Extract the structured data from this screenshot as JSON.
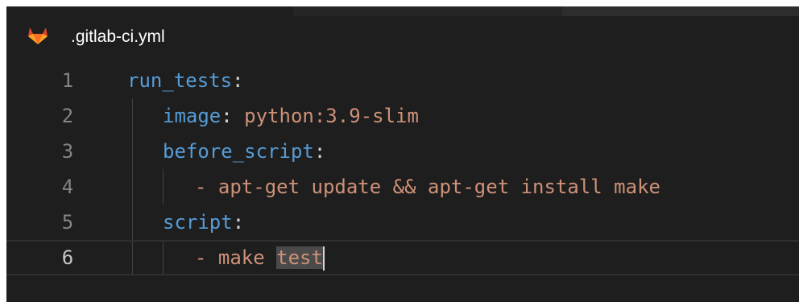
{
  "tab": {
    "filename": ".gitlab-ci.yml",
    "icon": "gitlab-icon"
  },
  "colors": {
    "background": "#1e1e1e",
    "yaml_key": "#569cd6",
    "yaml_value": "#ce9178",
    "line_number": "#858585",
    "line_number_current": "#c6c6c6",
    "gitlab_orange": "#e24329"
  },
  "editor": {
    "current_line": 6,
    "lines": [
      {
        "number": "1",
        "key": "run_tests",
        "sep": ":",
        "value": ""
      },
      {
        "number": "2",
        "key": "image",
        "sep": ": ",
        "value": "python:3.9-slim"
      },
      {
        "number": "3",
        "key": "before_script",
        "sep": ":",
        "value": ""
      },
      {
        "number": "4",
        "dash": "- ",
        "value": "apt-get update && apt-get install make"
      },
      {
        "number": "5",
        "key": "script",
        "sep": ":",
        "value": ""
      },
      {
        "number": "6",
        "dash": "- ",
        "value_plain": "make ",
        "value_selected": "test"
      }
    ]
  }
}
